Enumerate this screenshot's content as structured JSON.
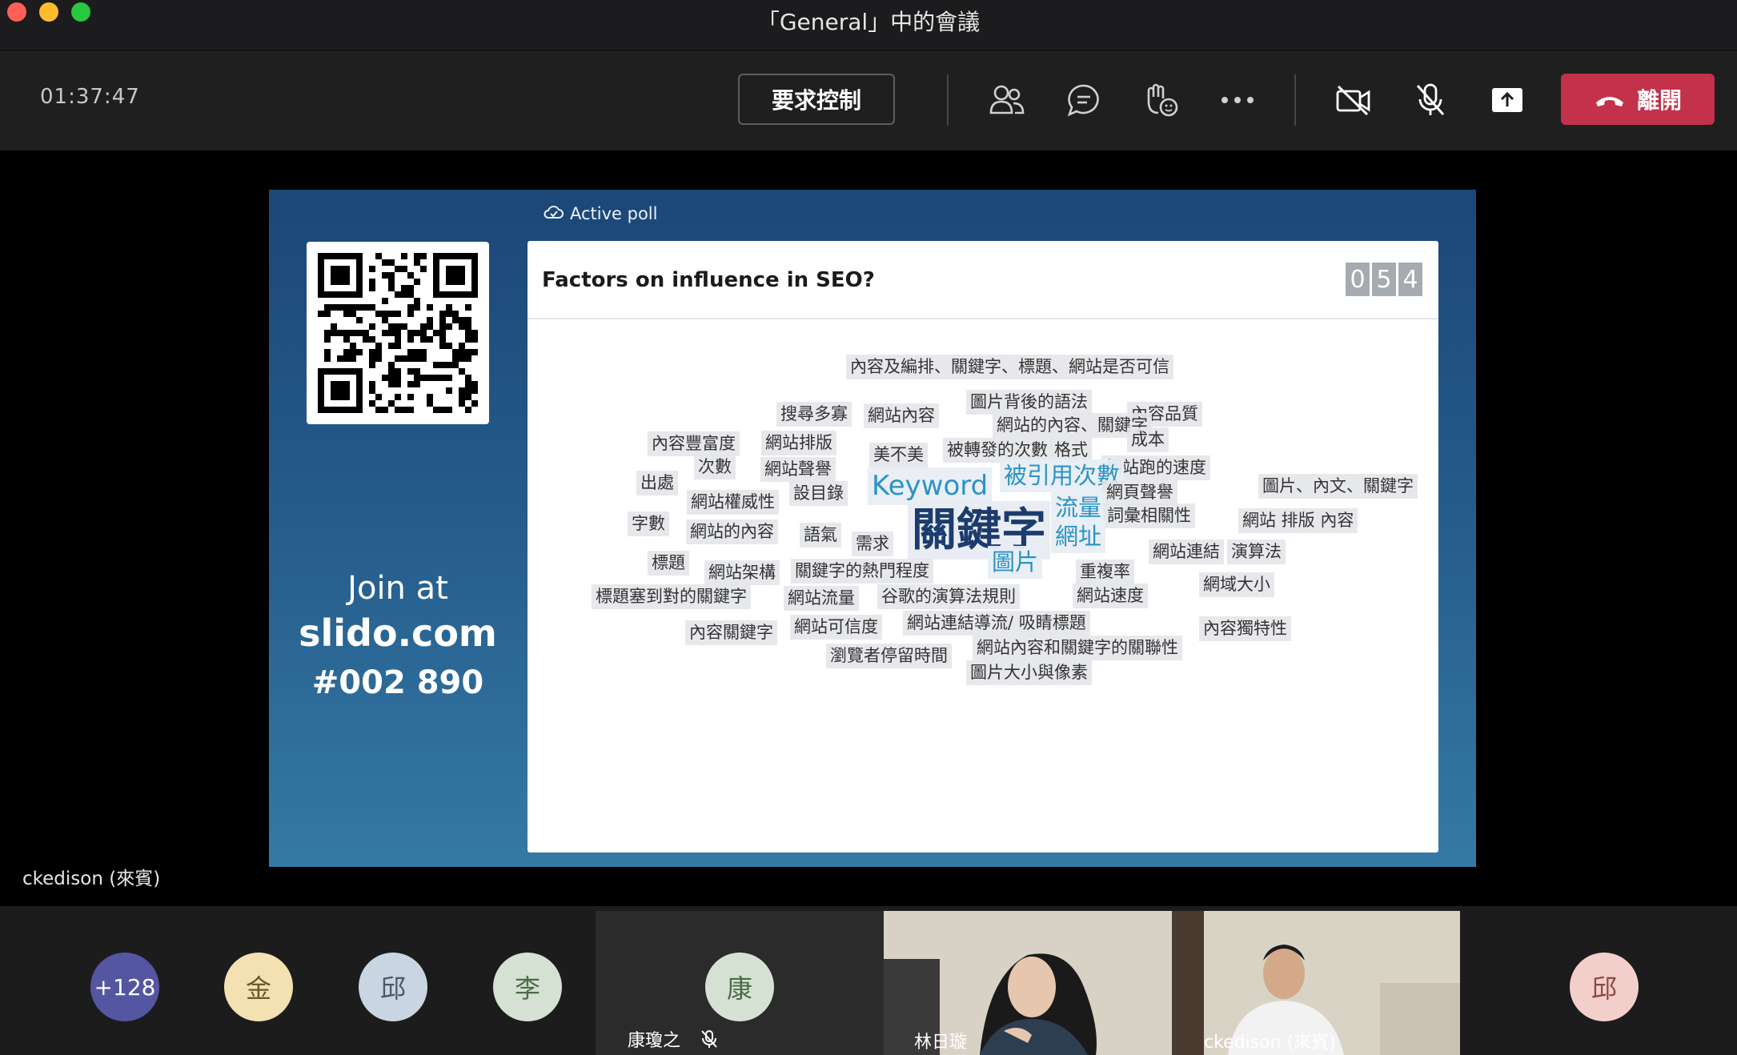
{
  "window": {
    "title": "「General」中的會議"
  },
  "toolbar": {
    "timer": "01:37:47",
    "request_control_label": "要求控制",
    "leave_label": "離開"
  },
  "slide": {
    "active_poll_label": "Active poll",
    "question": "Factors on influence in SEO?",
    "response_count_digits": [
      "0",
      "5",
      "4"
    ],
    "join_line1": "Join at",
    "join_line2": "slido.com",
    "join_line3": "#002 890",
    "word_cloud": [
      {
        "text": "內容及編排、關鍵字、標題、網站是否可信",
        "size": "small"
      },
      {
        "text": "圖片背後的語法",
        "size": "small"
      },
      {
        "text": "搜尋多寡",
        "size": "small"
      },
      {
        "text": "網站內容",
        "size": "small"
      },
      {
        "text": "內容品質",
        "size": "small"
      },
      {
        "text": "網站的內容、關鍵字",
        "size": "small"
      },
      {
        "text": "內容豐富度",
        "size": "small"
      },
      {
        "text": "網站排版",
        "size": "small"
      },
      {
        "text": "成本",
        "size": "small"
      },
      {
        "text": "美不美",
        "size": "small"
      },
      {
        "text": "被轉發的次數",
        "size": "small"
      },
      {
        "text": "格式",
        "size": "small"
      },
      {
        "text": "網站跑的速度",
        "size": "small"
      },
      {
        "text": "出處",
        "size": "small"
      },
      {
        "text": "次數",
        "size": "small"
      },
      {
        "text": "網站聲譽",
        "size": "small"
      },
      {
        "text": "Keyword",
        "size": "large"
      },
      {
        "text": "被引用次數",
        "size": "medium"
      },
      {
        "text": "圖片、內文、關鍵字",
        "size": "small"
      },
      {
        "text": "網站權威性",
        "size": "small"
      },
      {
        "text": "設目錄",
        "size": "small"
      },
      {
        "text": "網頁聲譽",
        "size": "small"
      },
      {
        "text": "流量",
        "size": "medium"
      },
      {
        "text": "詞彙相關性",
        "size": "small"
      },
      {
        "text": "網站 排版 內容",
        "size": "small"
      },
      {
        "text": "字數",
        "size": "small"
      },
      {
        "text": "網站的內容",
        "size": "small"
      },
      {
        "text": "關鍵字",
        "size": "xlarge"
      },
      {
        "text": "語氣",
        "size": "small"
      },
      {
        "text": "需求",
        "size": "small"
      },
      {
        "text": "網址",
        "size": "medium"
      },
      {
        "text": "網站連結",
        "size": "small"
      },
      {
        "text": "演算法",
        "size": "small"
      },
      {
        "text": "標題",
        "size": "small"
      },
      {
        "text": "網站架構",
        "size": "small"
      },
      {
        "text": "關鍵字的熱門程度",
        "size": "small"
      },
      {
        "text": "圖片",
        "size": "medium"
      },
      {
        "text": "重複率",
        "size": "small"
      },
      {
        "text": "網域大小",
        "size": "small"
      },
      {
        "text": "標題塞到對的關鍵字",
        "size": "small"
      },
      {
        "text": "網站流量",
        "size": "small"
      },
      {
        "text": "谷歌的演算法規則",
        "size": "small"
      },
      {
        "text": "網站速度",
        "size": "small"
      },
      {
        "text": "網站可信度",
        "size": "small"
      },
      {
        "text": "網站連結導流/ 吸睛標題",
        "size": "small"
      },
      {
        "text": "內容關鍵字",
        "size": "small"
      },
      {
        "text": "內容獨特性",
        "size": "small"
      },
      {
        "text": "瀏覽者停留時間",
        "size": "small"
      },
      {
        "text": "網站內容和關鍵字的關聯性",
        "size": "small"
      },
      {
        "text": "圖片大小與像素",
        "size": "small"
      }
    ]
  },
  "stage": {
    "speaker_name": "ckedison (來賓)"
  },
  "participants": {
    "overflow_count": "+128",
    "avatars": [
      {
        "initial": "金",
        "color": "#f4e1b1"
      },
      {
        "initial": "邱",
        "color": "#c9d6e1"
      },
      {
        "initial": "李",
        "color": "#d5e2d3"
      },
      {
        "initial": "康",
        "color": "#d5e2d3"
      },
      {
        "initial": "邱",
        "color": "#f3cfcc"
      }
    ],
    "tile_kang_name": "康瓊之",
    "tile_lin_name": "林日璇",
    "tile_ckedison_name": "ckedison (來賓)"
  },
  "colors": {
    "leave": "#c4314b",
    "overflow_avatar": "#5456a2",
    "keyword_blue": "#2b93c5",
    "keyword_dark": "#1c3c6e"
  }
}
